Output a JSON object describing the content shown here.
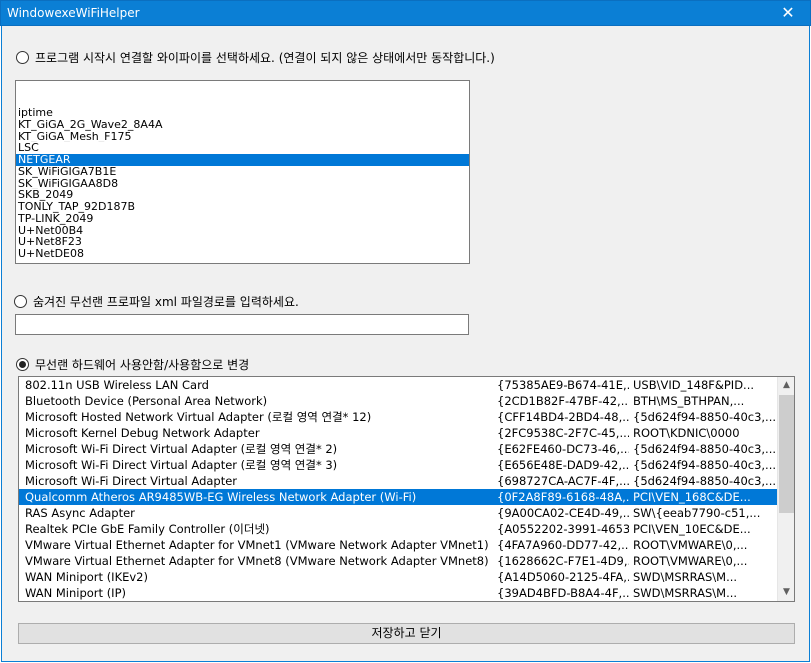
{
  "window": {
    "title": "WindowexeWiFiHelper",
    "close_glyph": "✕"
  },
  "option1": {
    "label": "프로그램 시작시 연결할 와이파이를 선택하세요. (연결이 되지 않은 상태에서만 동작합니다.)",
    "checked": false
  },
  "wifi_list": {
    "items": [
      "iptime",
      "KT_GiGA_2G_Wave2_8A4A",
      "KT_GiGA_Mesh_F175",
      "LSC",
      "NETGEAR",
      "SK_WiFiGIGA7B1E",
      "SK_WiFiGIGAA8D8",
      "SKB_2049",
      "TONLY_TAP_92D187B",
      "TP-LINK_2049",
      "U+Net00B4",
      "U+Net8F23",
      "U+NetDE08"
    ],
    "selected_index": 4
  },
  "option2": {
    "label": "숨겨진 무선랜 프로파일 xml 파일경로를 입력하세요.",
    "checked": false
  },
  "xml_path": {
    "value": "",
    "placeholder": ""
  },
  "option3": {
    "label": "무선랜 하드웨어 사용안함/사용함으로 변경",
    "checked": true
  },
  "adapter_list": {
    "rows": [
      [
        "802.11n USB Wireless LAN Card",
        "{75385AE9-B674-41E,...",
        "USB\\VID_148F&PID..."
      ],
      [
        "Bluetooth Device (Personal Area Network)",
        "{2CD1B82F-47BF-42,...",
        "BTH\\MS_BTHPAN,..."
      ],
      [
        "Microsoft Hosted Network Virtual Adapter (로컬 영역 연결* 12)",
        "{CFF14BD4-2BD4-48,...",
        "{5d624f94-8850-40c3,..."
      ],
      [
        "Microsoft Kernel Debug Network Adapter",
        "{2FC9538C-2F7C-45,...",
        "ROOT\\KDNIC\\0000"
      ],
      [
        "Microsoft Wi-Fi Direct Virtual Adapter (로컬 영역 연결* 2)",
        "{E62FE460-DC73-46,...",
        "{5d624f94-8850-40c3,..."
      ],
      [
        "Microsoft Wi-Fi Direct Virtual Adapter (로컬 영역 연결* 3)",
        "{E656E48E-DAD9-42,...",
        "{5d624f94-8850-40c3,..."
      ],
      [
        "Microsoft Wi-Fi Direct Virtual Adapter",
        "{698727CA-AC7F-4F,...",
        "{5d624f94-8850-40c3,..."
      ],
      [
        "Qualcomm Atheros AR9485WB-EG Wireless Network Adapter (Wi-Fi)",
        "{0F2A8F89-6168-48A,...",
        "PCI\\VEN_168C&DE..."
      ],
      [
        "RAS Async Adapter",
        "{9A00CA02-CE4D-49,...",
        "SW\\{eeab7790-c51,..."
      ],
      [
        "Realtek PCIe GbE Family Controller (이더넷)",
        "{A0552202-3991-4653,...",
        "PCI\\VEN_10EC&DE..."
      ],
      [
        "VMware Virtual Ethernet Adapter for VMnet1 (VMware Network Adapter VMnet1)",
        "{4FA7A960-DD77-42,...",
        "ROOT\\VMWARE\\0,..."
      ],
      [
        "VMware Virtual Ethernet Adapter for VMnet8 (VMware Network Adapter VMnet8)",
        "{1628662C-F7E1-4D9,...",
        "ROOT\\VMWARE\\0,..."
      ],
      [
        "WAN Miniport (IKEv2)",
        "{A14D5060-2125-4FA,...",
        "SWD\\MSRRAS\\M..."
      ],
      [
        "WAN Miniport (IP)",
        "{39AD4BFD-B8A4-4F,...",
        "SWD\\MSRRAS\\M..."
      ]
    ],
    "selected_index": 7,
    "scroll_up": "▲",
    "scroll_down": "▼"
  },
  "save_button": {
    "label": "저장하고 닫기"
  }
}
